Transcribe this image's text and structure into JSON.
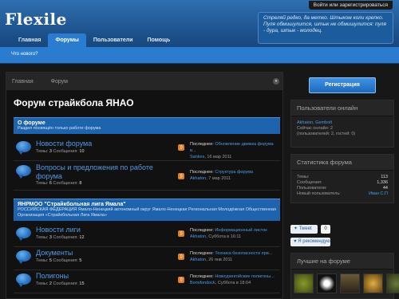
{
  "header": {
    "login_link": "Войти или зарегистрироваться",
    "logo": "Flexile",
    "quote": "Стреляй редко, да метко. Штыком коли крепко. Пуля обмишулится, штык не обмишулится: пуля - дура, штык - молодец.",
    "tabs": [
      "Главная",
      "Форумы",
      "Пользователи",
      "Помощь"
    ],
    "subnav_item": "Что нового?"
  },
  "breadcrumbs": [
    "Главная",
    "Форум"
  ],
  "page_title": "Форум страйкбола ЯНАО",
  "categories": [
    {
      "title": "О форуме",
      "description": "Раздел посвящён только работе форума",
      "forums": [
        {
          "title": "Новости форума",
          "topics_label": "Темы:",
          "topics": "3",
          "posts_label": "Сообщения:",
          "posts": "10",
          "last_label": "Последнее:",
          "last_title": "Обновление движка форума в...",
          "last_author": "Sankex",
          "last_date": ", 16 мар 2011"
        },
        {
          "title": "Вопросы и предложения по работе форума",
          "topics_label": "Темы:",
          "topics": "6",
          "posts_label": "Сообщения:",
          "posts": "8",
          "last_label": "Последнее:",
          "last_title": "Структура форума",
          "last_author": "Akhaton",
          "last_date": ", 7 мар 2011"
        }
      ]
    },
    {
      "title": "ЯНРМОО \"Страйкбольная лига Ямала\"",
      "description": "РОССИЙСКАЯ ФЕДЕРАЦИЯ Ямало-Ненецкий автономный округ Ямало-Ненецкая Региональная Молодёжная Общественная Организация «Страйкбольная Лига Ямала»",
      "forums": [
        {
          "title": "Новости лиги",
          "topics_label": "Темы:",
          "topics": "3",
          "posts_label": "Сообщения:",
          "posts": "12",
          "last_label": "Последнее:",
          "last_title": "Информационный листок",
          "last_author": "Akhaton",
          "last_date": ", Суббота в 16:11"
        },
        {
          "title": "Документы",
          "topics_label": "Темы:",
          "topics": "5",
          "posts_label": "Сообщения:",
          "posts": "5",
          "last_label": "Последнее:",
          "last_title": "Техника безопасности при...",
          "last_author": "Akhaton",
          "last_date": ", 26 янв 2011"
        },
        {
          "title": "Полигоны",
          "topics_label": "Темы:",
          "topics": "2",
          "posts_label": "Сообщения:",
          "posts": "15",
          "last_label": "Последнее:",
          "last_title": "Новоуренгойские полигоны...",
          "last_author": "Borisfondock",
          "last_date": ", Суббота в 18:04"
        }
      ]
    }
  ],
  "sidebar": {
    "register_button": "Регистрация",
    "online": {
      "title": "Пользователи онлайн",
      "users": "Akhaton, Gembolt",
      "now_label": "Сейчас онлайн: 2",
      "breakdown": "(пользователей: 2, гостей: 0)"
    },
    "stats": {
      "title": "Статистика форума",
      "rows": [
        {
          "label": "Темы:",
          "value": "113"
        },
        {
          "label": "Сообщения:",
          "value": "1,336"
        },
        {
          "label": "Пользователи:",
          "value": "44"
        },
        {
          "label": "Новый пользователь:",
          "value": "Иван С.П"
        }
      ]
    },
    "tweet_label": "Tweet",
    "tweet_count": "0",
    "recommend_label": "Я рекомендую",
    "best_title": "Лучшие на форуме"
  },
  "colors": {
    "header_blue": "#1a4d86",
    "accent_blue": "#2a7cd1",
    "link_blue": "#4f9ae6",
    "background": "#171717"
  }
}
